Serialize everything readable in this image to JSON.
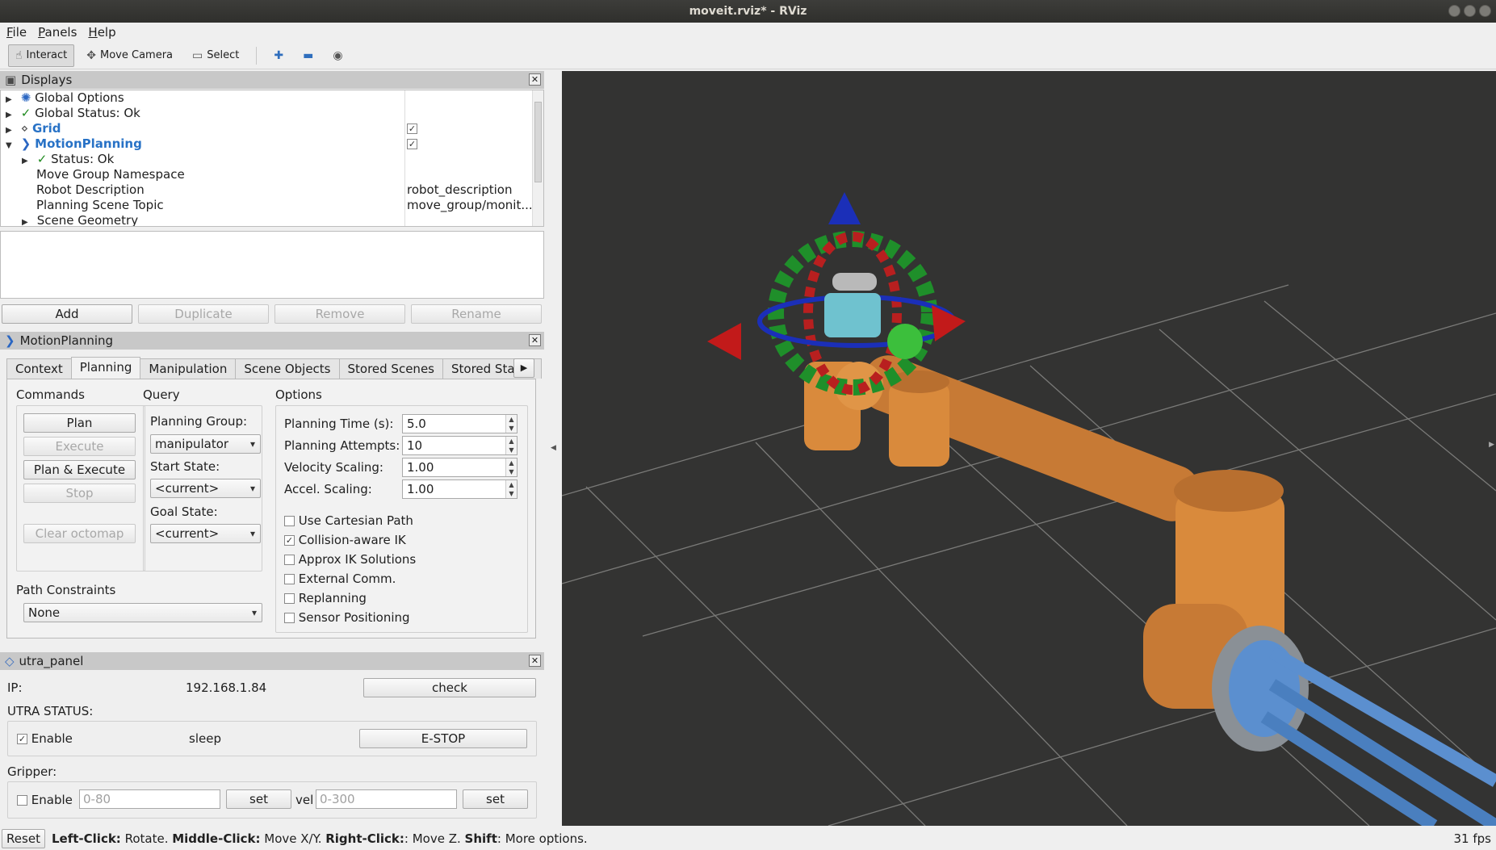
{
  "window": {
    "title": "moveit.rviz* - RViz"
  },
  "menu": [
    "File",
    "Panels",
    "Help"
  ],
  "toolbar": {
    "interact": "Interact",
    "move_camera": "Move Camera",
    "select": "Select"
  },
  "displays": {
    "title": "Displays",
    "rows": [
      {
        "label": "Global Options",
        "value": ""
      },
      {
        "label": "Global Status: Ok",
        "value": ""
      },
      {
        "label": "Grid",
        "value": ""
      },
      {
        "label": "MotionPlanning",
        "value": ""
      },
      {
        "label": "Status: Ok",
        "value": ""
      },
      {
        "label": "Move Group Namespace",
        "value": ""
      },
      {
        "label": "Robot Description",
        "value": "robot_description"
      },
      {
        "label": "Planning Scene Topic",
        "value": "move_group/monit..."
      },
      {
        "label": "Scene Geometry",
        "value": ""
      }
    ],
    "buttons": {
      "add": "Add",
      "duplicate": "Duplicate",
      "remove": "Remove",
      "rename": "Rename"
    }
  },
  "motion_planning": {
    "title": "MotionPlanning",
    "tabs": [
      "Context",
      "Planning",
      "Manipulation",
      "Scene Objects",
      "Stored Scenes",
      "Stored States"
    ],
    "commands": {
      "title": "Commands",
      "plan": "Plan",
      "execute": "Execute",
      "plan_execute": "Plan & Execute",
      "stop": "Stop",
      "clear_octomap": "Clear octomap"
    },
    "query": {
      "title": "Query",
      "planning_group_label": "Planning Group:",
      "planning_group": "manipulator",
      "start_state_label": "Start State:",
      "start_state": "<current>",
      "goal_state_label": "Goal State:",
      "goal_state": "<current>"
    },
    "options": {
      "title": "Options",
      "planning_time_label": "Planning Time (s):",
      "planning_time": "5.0",
      "planning_attempts_label": "Planning Attempts:",
      "planning_attempts": "10",
      "velocity_scaling_label": "Velocity Scaling:",
      "velocity_scaling": "1.00",
      "accel_scaling_label": "Accel. Scaling:",
      "accel_scaling": "1.00",
      "checks": [
        {
          "label": "Use Cartesian Path",
          "checked": false
        },
        {
          "label": "Collision-aware IK",
          "checked": true
        },
        {
          "label": "Approx IK Solutions",
          "checked": false
        },
        {
          "label": "External Comm.",
          "checked": false
        },
        {
          "label": "Replanning",
          "checked": false
        },
        {
          "label": "Sensor Positioning",
          "checked": false
        }
      ]
    },
    "path_constraints": {
      "label": "Path Constraints",
      "value": "None"
    }
  },
  "utra_panel": {
    "title": "utra_panel",
    "ip_label": "IP:",
    "ip_value": "192.168.1.84",
    "check_button": "check",
    "status_label": "UTRA STATUS:",
    "enable_label": "Enable",
    "state": "sleep",
    "estop_button": "E-STOP",
    "gripper_label": "Gripper:",
    "gripper_enable_label": "Enable",
    "pos_placeholder": "0-80",
    "set_button": "set",
    "vel_label": "vel",
    "vel_placeholder": "0-300",
    "set_button_2": "set"
  },
  "statusbar": {
    "reset": "Reset",
    "left_click": "Left-Click:",
    "rotate": " Rotate. ",
    "middle_click": "Middle-Click:",
    "move_xy": " Move X/Y. ",
    "right_click": "Right-Click:",
    "move_z": ": Move Z. ",
    "shift": "Shift",
    "more": ": More options.",
    "fps": "31 fps"
  },
  "colors": {
    "accent_blue": "#2872c6",
    "viewport_bg": "#333332",
    "robot": "#d98a3c",
    "tool": "#5b8fcf"
  }
}
